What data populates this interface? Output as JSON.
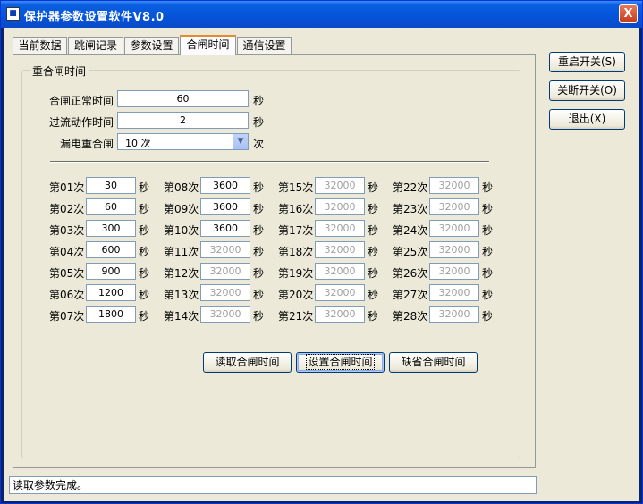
{
  "window": {
    "title": "保护器参数设置软件V8.0",
    "close_label": "X"
  },
  "tabs": [
    {
      "label": "当前数据"
    },
    {
      "label": "跳闸记录"
    },
    {
      "label": "参数设置"
    },
    {
      "label": "合闸时间",
      "active": true
    },
    {
      "label": "通信设置"
    }
  ],
  "group": {
    "title": "重合闸时间"
  },
  "fields": {
    "normal_time": {
      "label": "合闸正常时间",
      "value": "60",
      "unit": "秒"
    },
    "overcurrent_time": {
      "label": "过流动作时间",
      "value": "2",
      "unit": "秒"
    },
    "leakage_reclose": {
      "label": "漏电重合闸",
      "value": "10 次",
      "unit": "次"
    }
  },
  "reclose_unit": "秒",
  "reclose_times": [
    {
      "label": "第01次",
      "value": "30",
      "enabled": true
    },
    {
      "label": "第02次",
      "value": "60",
      "enabled": true
    },
    {
      "label": "第03次",
      "value": "300",
      "enabled": true
    },
    {
      "label": "第04次",
      "value": "600",
      "enabled": true
    },
    {
      "label": "第05次",
      "value": "900",
      "enabled": true
    },
    {
      "label": "第06次",
      "value": "1200",
      "enabled": true
    },
    {
      "label": "第07次",
      "value": "1800",
      "enabled": true
    },
    {
      "label": "第08次",
      "value": "3600",
      "enabled": true
    },
    {
      "label": "第09次",
      "value": "3600",
      "enabled": true
    },
    {
      "label": "第10次",
      "value": "3600",
      "enabled": true
    },
    {
      "label": "第11次",
      "value": "32000",
      "enabled": false
    },
    {
      "label": "第12次",
      "value": "32000",
      "enabled": false
    },
    {
      "label": "第13次",
      "value": "32000",
      "enabled": false
    },
    {
      "label": "第14次",
      "value": "32000",
      "enabled": false
    },
    {
      "label": "第15次",
      "value": "32000",
      "enabled": false
    },
    {
      "label": "第16次",
      "value": "32000",
      "enabled": false
    },
    {
      "label": "第17次",
      "value": "32000",
      "enabled": false
    },
    {
      "label": "第18次",
      "value": "32000",
      "enabled": false
    },
    {
      "label": "第19次",
      "value": "32000",
      "enabled": false
    },
    {
      "label": "第20次",
      "value": "32000",
      "enabled": false
    },
    {
      "label": "第21次",
      "value": "32000",
      "enabled": false
    },
    {
      "label": "第22次",
      "value": "32000",
      "enabled": false
    },
    {
      "label": "第23次",
      "value": "32000",
      "enabled": false
    },
    {
      "label": "第24次",
      "value": "32000",
      "enabled": false
    },
    {
      "label": "第25次",
      "value": "32000",
      "enabled": false
    },
    {
      "label": "第26次",
      "value": "32000",
      "enabled": false
    },
    {
      "label": "第27次",
      "value": "32000",
      "enabled": false
    },
    {
      "label": "第28次",
      "value": "32000",
      "enabled": false
    }
  ],
  "actions": {
    "read": "读取合闸时间",
    "set": "设置合闸时间",
    "default": "缺省合闸时间"
  },
  "side_buttons": {
    "restart": "重启开关(S)",
    "shutdown": "关断开关(O)",
    "exit": "退出(X)"
  },
  "status": {
    "text": "读取参数完成。"
  }
}
